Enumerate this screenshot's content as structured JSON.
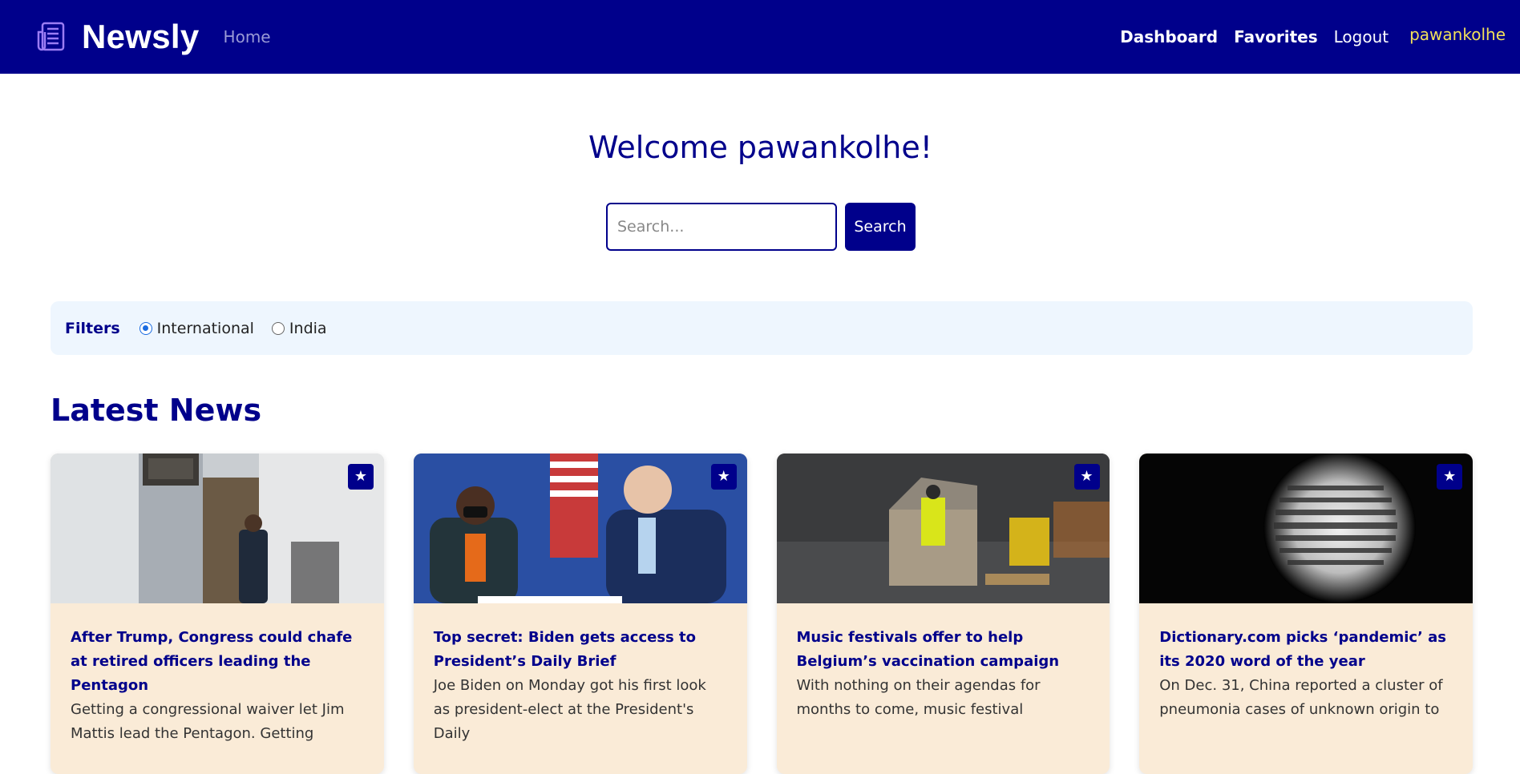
{
  "navbar": {
    "brand": "Newsly",
    "home": "Home",
    "links": [
      "Dashboard",
      "Favorites",
      "Logout"
    ],
    "username": "pawankolhe",
    "colors": {
      "background": "#00008b",
      "username": "#f1e05a"
    }
  },
  "welcome": {
    "heading": "Welcome pawankolhe!"
  },
  "search": {
    "placeholder": "Search...",
    "button": "Search"
  },
  "filters": {
    "label": "Filters",
    "options": [
      "International",
      "India"
    ],
    "selected": "International"
  },
  "latest": {
    "title": "Latest News",
    "articles": [
      {
        "title": "After Trump, Congress could chafe at retired officers leading the Pentagon",
        "description": "Getting a congressional waiver let Jim Mattis lead the Pentagon. Getting",
        "image_icon": "photo-pentagon",
        "fav_icon": "★"
      },
      {
        "title": "Top secret: Biden gets access to President’s Daily Brief",
        "description": "Joe Biden on Monday got his first look as president-elect at the President's Daily",
        "image_icon": "photo-biden-harris",
        "fav_icon": "★"
      },
      {
        "title": "Music festivals offer to help Belgium’s vaccination campaign",
        "description": "With nothing on their agendas for months to come, music festival",
        "image_icon": "photo-warehouse",
        "fav_icon": "★"
      },
      {
        "title": "Dictionary.com picks ‘pandemic’ as its 2020 word of the year",
        "description": "On Dec. 31, China reported a cluster of pneumonia cases of unknown origin to",
        "image_icon": "photo-magnifier-dictionary",
        "fav_icon": "★"
      }
    ]
  }
}
